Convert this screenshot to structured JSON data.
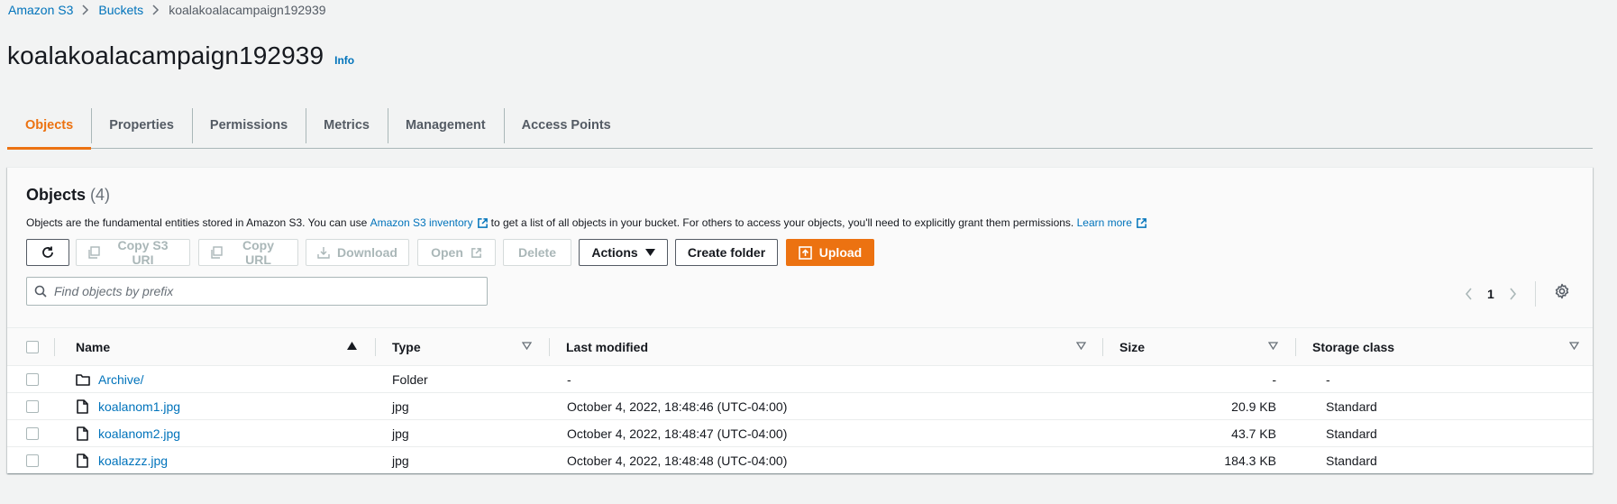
{
  "breadcrumb": {
    "root": "Amazon S3",
    "buckets": "Buckets",
    "current": "koalakoalacampaign192939"
  },
  "header": {
    "title": "koalakoalacampaign192939",
    "info": "Info"
  },
  "tabs": [
    {
      "label": "Objects",
      "active": true
    },
    {
      "label": "Properties"
    },
    {
      "label": "Permissions"
    },
    {
      "label": "Metrics"
    },
    {
      "label": "Management"
    },
    {
      "label": "Access Points"
    }
  ],
  "objects_panel": {
    "title": "Objects",
    "count": "(4)",
    "description_pre": "Objects are the fundamental entities stored in Amazon S3. You can use",
    "inventory_link": "Amazon S3 inventory",
    "description_post": "to get a list of all objects in your bucket. For others to access your objects, you'll need to explicitly grant them permissions.",
    "learn_more": "Learn more",
    "buttons": {
      "copy_s3_uri": "Copy S3 URI",
      "copy_url": "Copy URL",
      "download": "Download",
      "open": "Open",
      "delete": "Delete",
      "actions": "Actions",
      "create_folder": "Create folder",
      "upload": "Upload"
    },
    "search_placeholder": "Find objects by prefix",
    "page": "1"
  },
  "table": {
    "columns": {
      "name": "Name",
      "type": "Type",
      "last_modified": "Last modified",
      "size": "Size",
      "storage_class": "Storage class"
    },
    "rows": [
      {
        "name": "Archive/",
        "type": "Folder",
        "last_modified": "-",
        "size": "-",
        "storage_class": "-",
        "icon": "folder-icon"
      },
      {
        "name": "koalanom1.jpg",
        "type": "jpg",
        "last_modified": "October 4, 2022, 18:48:46 (UTC-04:00)",
        "size": "20.9 KB",
        "storage_class": "Standard",
        "icon": "file-icon"
      },
      {
        "name": "koalanom2.jpg",
        "type": "jpg",
        "last_modified": "October 4, 2022, 18:48:47 (UTC-04:00)",
        "size": "43.7 KB",
        "storage_class": "Standard",
        "icon": "file-icon"
      },
      {
        "name": "koalazzz.jpg",
        "type": "jpg",
        "last_modified": "October 4, 2022, 18:48:48 (UTC-04:00)",
        "size": "184.3 KB",
        "storage_class": "Standard",
        "icon": "file-icon"
      }
    ]
  },
  "colors": {
    "accent": "#ec7211",
    "link": "#0073bb",
    "background": "#f2f3f3"
  }
}
